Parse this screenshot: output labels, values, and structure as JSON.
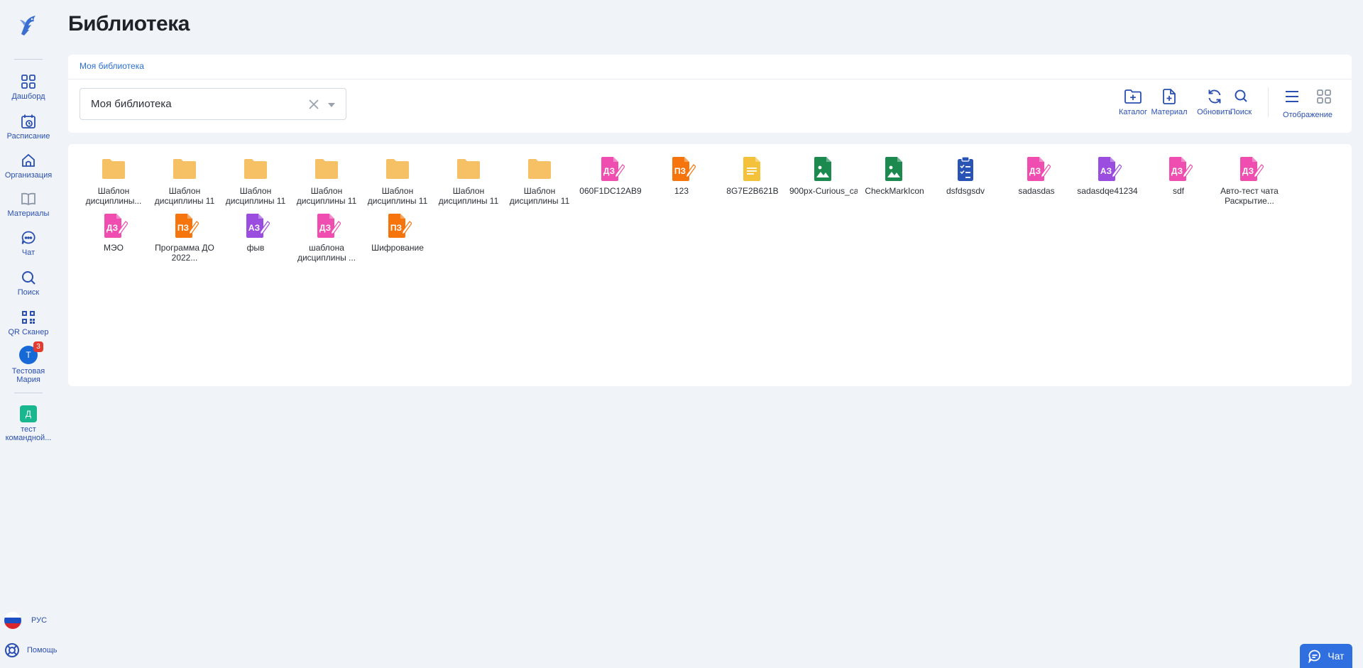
{
  "page": {
    "title": "Библиотека"
  },
  "sidebar": {
    "items": [
      {
        "label": "Дашборд",
        "icon": "dashboard-icon"
      },
      {
        "label": "Расписание",
        "icon": "calendar-icon"
      },
      {
        "label": "Организация",
        "icon": "home-icon"
      },
      {
        "label": "Материалы",
        "icon": "book-icon"
      },
      {
        "label": "Чат",
        "icon": "chat-icon"
      },
      {
        "label": "Поиск",
        "icon": "search-icon"
      },
      {
        "label": "QR Сканер",
        "icon": "qr-icon"
      }
    ],
    "user": {
      "name": "Тестовая Мария",
      "initial": "Т",
      "badge": "3"
    },
    "team": {
      "name": "тест командной...",
      "initial": "Д"
    },
    "language": "РУС",
    "help": "Помощь"
  },
  "toolbar": {
    "breadcrumb": "Моя библиотека",
    "select_value": "Моя библиотека",
    "buttons": {
      "catalog": "Каталог",
      "material": "Материал",
      "refresh": "Обновить",
      "search": "Поиск",
      "display": "Отображение"
    }
  },
  "files": [
    {
      "name": "Шаблон дисциплины...",
      "type": "folder"
    },
    {
      "name": "Шаблон дисциплины 11",
      "type": "folder"
    },
    {
      "name": "Шаблон дисциплины 11",
      "type": "folder"
    },
    {
      "name": "Шаблон дисциплины 11",
      "type": "folder"
    },
    {
      "name": "Шаблон дисциплины 11",
      "type": "folder"
    },
    {
      "name": "Шаблон дисциплины 11",
      "type": "folder"
    },
    {
      "name": "Шаблон дисциплины 11",
      "type": "folder"
    },
    {
      "name": "060F1DC12AB9",
      "type": "homework",
      "badge": "ДЗ"
    },
    {
      "name": "123",
      "type": "practice",
      "badge": "ПЗ"
    },
    {
      "name": "8G7E2B621B",
      "type": "document"
    },
    {
      "name": "900px-Curious_cat_sta",
      "type": "image"
    },
    {
      "name": "CheckMarkIcon",
      "type": "image"
    },
    {
      "name": "dsfdsgsdv",
      "type": "test"
    },
    {
      "name": "sadasdas",
      "type": "homework",
      "badge": "ДЗ"
    },
    {
      "name": "sadasdqe41234",
      "type": "assignment",
      "badge": "АЗ"
    },
    {
      "name": "sdf",
      "type": "homework",
      "badge": "ДЗ"
    },
    {
      "name": "Авто-тест чата Раскрытие...",
      "type": "homework",
      "badge": "ДЗ"
    },
    {
      "name": "МЭО",
      "type": "homework",
      "badge": "ДЗ"
    },
    {
      "name": "Программа ДО 2022...",
      "type": "practice",
      "badge": "ПЗ"
    },
    {
      "name": "фыв",
      "type": "assignment",
      "badge": "АЗ"
    },
    {
      "name": "шаблона дисциплины ...",
      "type": "homework",
      "badge": "ДЗ"
    },
    {
      "name": "Шифрование",
      "type": "practice",
      "badge": "ПЗ"
    }
  ],
  "chat_button": "Чат",
  "colors": {
    "accent": "#2a4fb0",
    "folder": "#f6c065",
    "homework": "#ef4db0",
    "practice": "#f5750c",
    "assignment": "#9b4de0",
    "document": "#f4c13a",
    "image": "#1c8a4f",
    "test": "#2953b5"
  }
}
